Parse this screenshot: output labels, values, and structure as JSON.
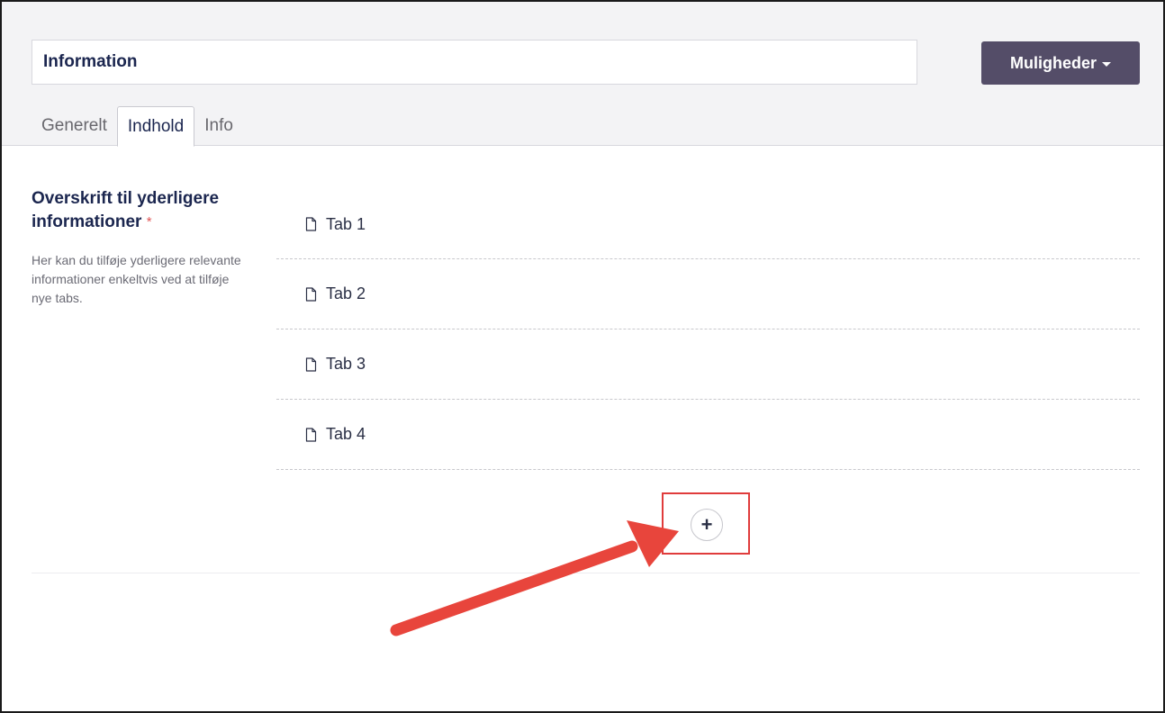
{
  "header": {
    "name_value": "Information",
    "options_label": "Muligheder"
  },
  "tabs": [
    {
      "label": "Generelt"
    },
    {
      "label": "Indhold"
    },
    {
      "label": "Info"
    }
  ],
  "property": {
    "label": "Overskrift til yderligere informationer",
    "required_mark": "*",
    "description": "Her kan du tilføje yderligere relevante informationer enkeltvis ved at tilføje nye tabs."
  },
  "tab_items": [
    {
      "label": "Tab 1"
    },
    {
      "label": "Tab 2"
    },
    {
      "label": "Tab 3"
    },
    {
      "label": "Tab 4"
    }
  ],
  "add_button": {
    "label": "+"
  },
  "colors": {
    "options_button": "#544d68",
    "highlight": "#e03c3c",
    "arrow": "#e8453c"
  },
  "icons": {
    "tab_item": "document-icon",
    "add": "plus-icon",
    "options_caret": "caret-down-icon"
  }
}
